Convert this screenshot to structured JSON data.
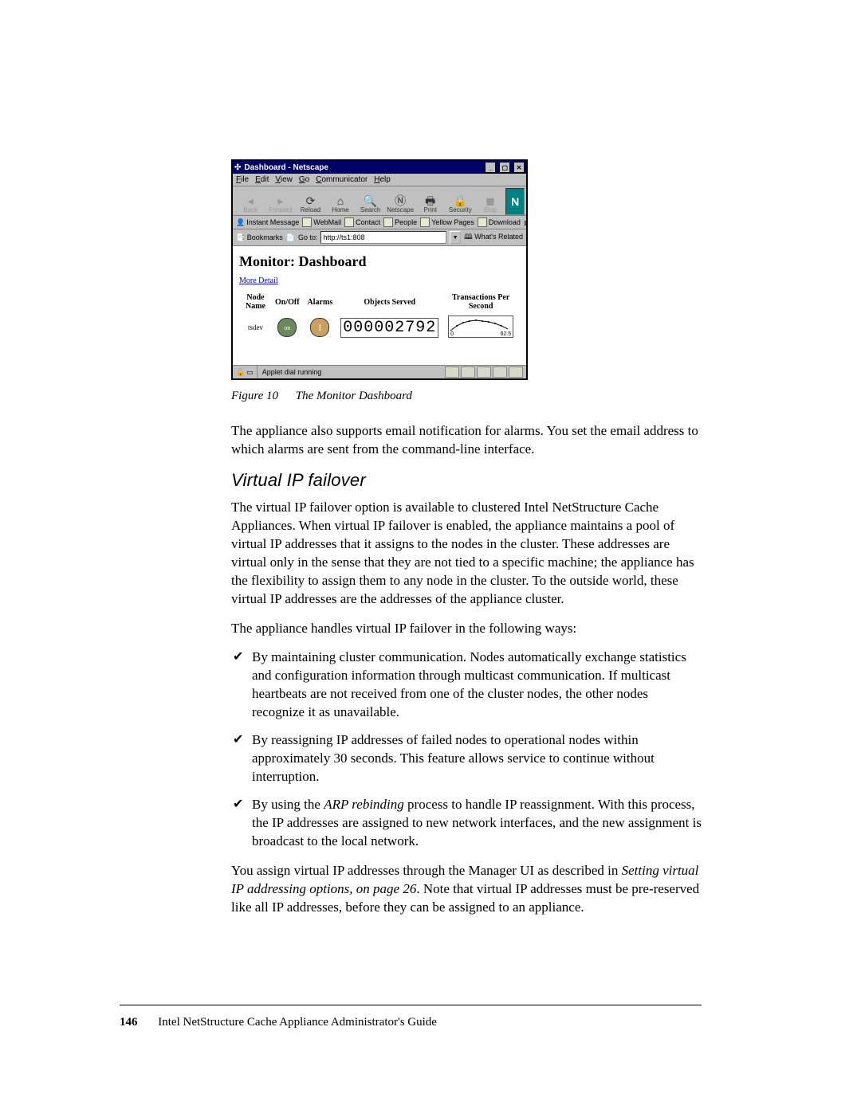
{
  "browser": {
    "title": "Dashboard - Netscape",
    "menus": {
      "file": "File",
      "edit": "Edit",
      "view": "View",
      "go": "Go",
      "communicator": "Communicator",
      "help": "Help"
    },
    "toolbar": {
      "back": "Back",
      "forward": "Forward",
      "reload": "Reload",
      "home": "Home",
      "search": "Search",
      "netscape": "Netscape",
      "print": "Print",
      "security": "Security",
      "stop": "Stop"
    },
    "linkbar": {
      "instant": "Instant Message",
      "webmail": "WebMail",
      "contact": "Contact",
      "people": "People",
      "yellow": "Yellow Pages",
      "download": "Download",
      "ch": "Ch"
    },
    "address": {
      "bookmarks": "Bookmarks",
      "goto": "Go to:",
      "url": "http://ts1:808",
      "related": "What's Related"
    },
    "dashboard": {
      "heading": "Monitor: Dashboard",
      "more": "More Detail",
      "cols": {
        "node": "Node Name",
        "onoff": "On/Off",
        "alarms": "Alarms",
        "objs": "Objects Served",
        "tps": "Transactions Per Second"
      },
      "row": {
        "node": "tsdev",
        "on": "on",
        "alarm": "!",
        "objects": "000002792",
        "lo": "0",
        "hi": "62.5"
      }
    },
    "status": {
      "msg": "Applet dial running"
    }
  },
  "caption": {
    "label": "Figure 10",
    "title": "The Monitor Dashboard"
  },
  "p_after_fig": "The appliance also supports email notification for alarms. You set the email address to which alarms are sent from the command-line interface.",
  "section_heading": "Virtual IP failover",
  "p_intro": "The virtual IP failover option is available to clustered Intel NetStructure Cache Appliances. When virtual IP failover is enabled, the appliance maintains a pool of virtual IP addresses that it assigns to the nodes in the cluster. These addresses are virtual only in the sense that they are not tied to a specific machine; the appliance has the flexibility to assign them to any node in the cluster. To the outside world, these virtual IP addresses are the addresses of the appliance cluster.",
  "p_lead": "The appliance handles virtual IP failover in the following ways:",
  "bullets": {
    "b1": "By maintaining cluster communication. Nodes automatically exchange statistics and configuration information through multicast communication. If multicast heartbeats are not received from one of the cluster nodes, the other nodes recognize it as unavailable.",
    "b2": "By reassigning IP addresses of failed nodes to operational nodes within approximately 30 seconds. This feature allows service to continue without interruption.",
    "b3_a": "By using the ",
    "b3_i": "ARP rebinding",
    "b3_b": " process to handle IP reassignment. With this process, the IP addresses are assigned to new network interfaces, and the new assignment is broadcast to the local network."
  },
  "p_tail_a": "You assign virtual IP addresses through the Manager UI as described in ",
  "p_tail_i": "Setting virtual IP addressing options, on page 26",
  "p_tail_b": ". Note that virtual IP addresses must be pre-reserved like all IP addresses, before they can be assigned to an appliance.",
  "footer": {
    "page": "146",
    "book": "Intel NetStructure Cache Appliance Administrator's Guide"
  }
}
